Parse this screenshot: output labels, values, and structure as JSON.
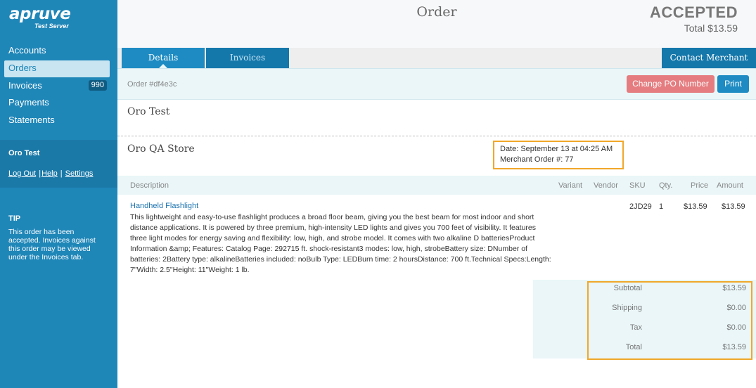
{
  "brand": {
    "name": "apruve",
    "subtitle": "Test Server"
  },
  "sidebar": {
    "items": [
      {
        "label": "Accounts"
      },
      {
        "label": "Orders"
      },
      {
        "label": "Invoices",
        "badge": "990"
      },
      {
        "label": "Payments"
      },
      {
        "label": "Statements"
      }
    ],
    "user": "Oro Test",
    "links": [
      "Log Out",
      "Help",
      "Settings"
    ],
    "tip_title": "TIP",
    "tip_text": "This order has been accepted. Invoices against this order may be viewed under the Invoices tab."
  },
  "header": {
    "title": "Order",
    "status": "ACCEPTED",
    "total": "Total $13.59"
  },
  "tabs": {
    "details": "Details",
    "invoices": "Invoices",
    "contact": "Contact Merchant"
  },
  "actions": {
    "order_id": "Order #df4e3c",
    "change_po": "Change PO Number",
    "print": "Print"
  },
  "buyer": "Oro Test",
  "merchant": "Oro QA Store",
  "meta": {
    "date": "Date: September 13 at 04:25 AM",
    "merchant_order": "Merchant Order #: 77"
  },
  "table": {
    "headers": {
      "description": "Description",
      "variant": "Variant",
      "vendor": "Vendor",
      "sku": "SKU",
      "qty": "Qty.",
      "price": "Price",
      "amount": "Amount"
    },
    "items": [
      {
        "name": "Handheld Flashlight",
        "description": "This lightweight and easy-to-use flashlight produces a broad floor beam, giving you the best beam for most indoor and short distance applications. It is powered by three premium, high-intensity LED lights and gives you 700 feet of visibility. It features three light modes for energy saving and flexibility: low, high, and strobe model. It comes with two alkaline D batteriesProduct Information &amp; Features: Catalog Page: 292715 ft. shock-resistant3 modes: low, high, strobeBattery size: DNumber of batteries: 2Battery type: alkalineBatteries included: noBulb Type: LEDBurn time: 2 hoursDistance: 700 ft.Technical Specs:Length: 7\"Width: 2.5\"Height: 11\"Weight: 1 lb.",
        "sku": "2JD29",
        "qty": "1",
        "price": "$13.59",
        "amount": "$13.59"
      }
    ]
  },
  "totals": {
    "subtotal_label": "Subtotal",
    "subtotal": "$13.59",
    "shipping_label": "Shipping",
    "shipping": "$0.00",
    "tax_label": "Tax",
    "tax": "$0.00",
    "total_label": "Total",
    "total": "$13.59"
  }
}
